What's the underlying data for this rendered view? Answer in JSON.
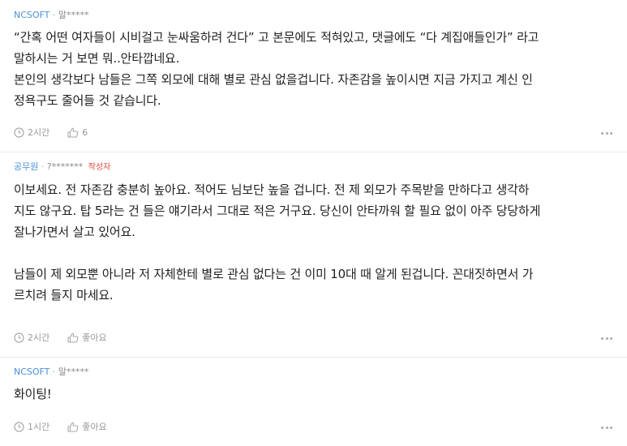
{
  "comments": [
    {
      "company": "NCSOFT",
      "separator": "·",
      "nickname": "말*****",
      "author_tag": "",
      "lines": [
        "“간혹 어떤 여자들이 시비걸고 눈싸움하려 건다” 고 본문에도 적혀있고, 댓글에도 “다 계집애들인가” 라고",
        "말하시는 거 보면 뭐..안타깝네요.",
        "본인의 생각보다 남들은 그쪽 외모에 대해 별로 관심 없을겁니다. 자존감을 높이시면 지금 가지고 계신 인",
        "정욕구도 줄어들 것 같습니다."
      ],
      "time": "2시간",
      "like_label": "6"
    },
    {
      "company": "공무원",
      "separator": "·",
      "nickname": "?*******",
      "author_tag": "작성자",
      "lines": [
        "이보세요. 전 자존감 충분히 높아요. 적어도 님보단 높을 겁니다. 전 제 외모가 주목받을 만하다고 생각하",
        "지도 않구요. 탑 5라는 건 들은 얘기라서 그대로 적은 거구요. 당신이 안타까워 할 필요 없이 아주 당당하게",
        "잘나가면서 살고 있어요.",
        "",
        "남들이 제 외모뿐 아니라 저 자체한테 별로 관심 없다는 건 이미 10대 때 알게 된겁니다. 꼰대짓하면서 가",
        "르치려 들지 마세요."
      ],
      "time": "2시간",
      "like_label": "좋아요"
    },
    {
      "company": "NCSOFT",
      "separator": "·",
      "nickname": "말*****",
      "author_tag": "",
      "lines": [
        "화이팅!"
      ],
      "time": "1시간",
      "like_label": "좋아요"
    }
  ],
  "icons": {
    "time": "clock-icon",
    "like": "thumbs-up-icon",
    "more": "more-options-icon"
  }
}
